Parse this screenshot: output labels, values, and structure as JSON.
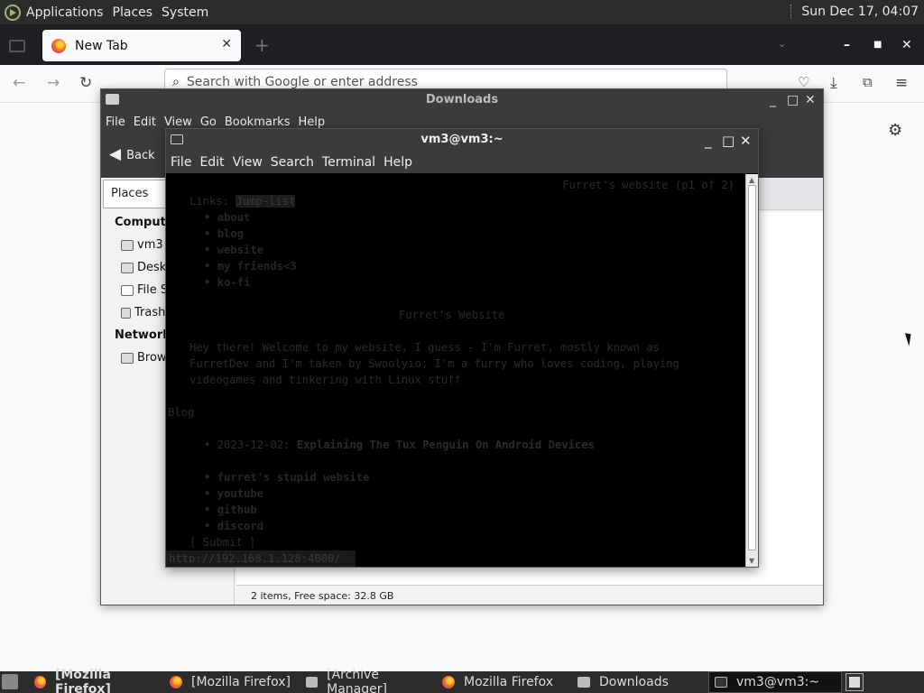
{
  "top_panel": {
    "menus": [
      "Applications",
      "Places",
      "System"
    ],
    "clock": "Sun Dec 17, 04:07"
  },
  "firefox": {
    "tab_title": "New Tab",
    "url_placeholder": "Search with Google or enter address"
  },
  "nautilus": {
    "title": "Downloads",
    "menu": [
      "File",
      "Edit",
      "View",
      "Go",
      "Bookmarks",
      "Help"
    ],
    "back_label": "Back",
    "places_label": "Places",
    "sidebar": {
      "computer_header": "Compute",
      "computer_items": [
        "vm3",
        "Deskt",
        "File S",
        "Trash"
      ],
      "network_header": "Network",
      "network_items": [
        "Brow"
      ]
    },
    "status": "2 items, Free space: 32.8 GB"
  },
  "terminal": {
    "title": "vm3@vm3:~",
    "menu": [
      "File",
      "Edit",
      "View",
      "Search",
      "Terminal",
      "Help"
    ],
    "page_indicator": "Furret's website (p1 of 2)",
    "links_label": "Links:",
    "links_highlight": "Jump-list",
    "nav_links": [
      "about",
      "blog",
      "website",
      "my friends<3",
      "ko-fi"
    ],
    "site_title": "Furret's Website",
    "intro": [
      "Hey there! Welcome to my website, I guess - I'm Furret, mostly known as",
      "FurretDev and I'm taken by Swoolyio; I'm a furry who loves coding, playing",
      "videogames and tinkering with Linux stuff"
    ],
    "blog_heading": "Blog",
    "blog_date": "2023-12-02:",
    "blog_title": "Explaining The Tux Penguin On Android Devices",
    "footer_links": [
      "furret's stupid website",
      "youtube",
      "github",
      "discord"
    ],
    "submit": "[ Submit ]",
    "status_url": "http://192.168.1.128:4000/"
  },
  "taskbar": {
    "tasks": [
      "[Mozilla Firefox]",
      "[Mozilla Firefox]",
      "[Archive Manager]",
      "Mozilla Firefox",
      "Downloads",
      "vm3@vm3:~"
    ]
  }
}
